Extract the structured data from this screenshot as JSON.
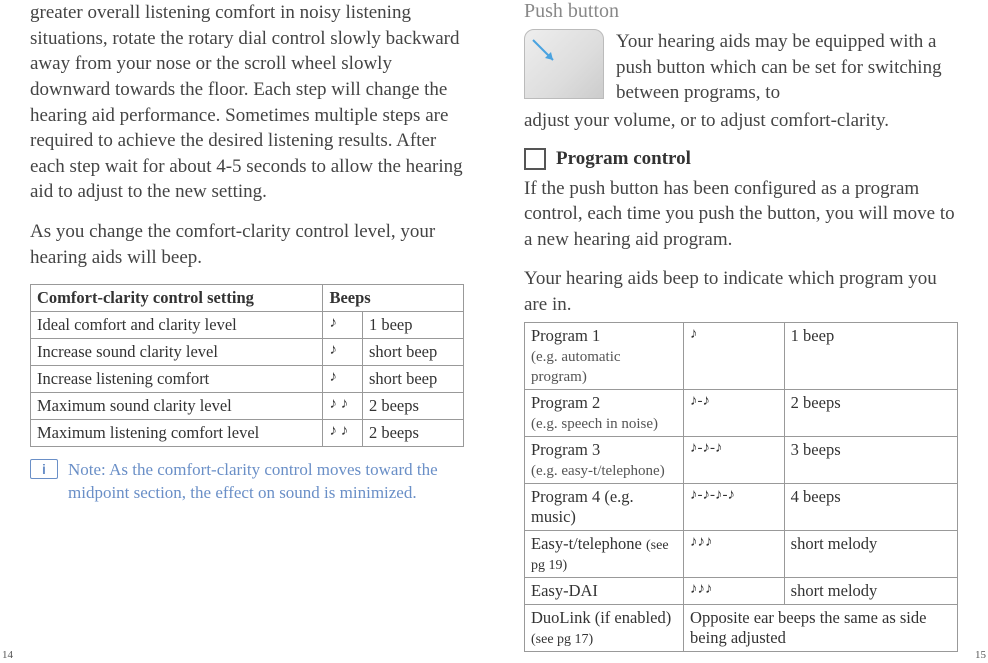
{
  "left": {
    "para1": "greater overall listening comfort in noisy listening situations, rotate the rotary dial control slowly backward away from your nose or the scroll wheel slowly downward towards the floor. Each step will change the hearing aid performance. Sometimes multiple steps are required to achieve the desired listening results. After each step wait for about 4-5 seconds to allow the hearing aid to adjust to the new setting.",
    "para2": "As you change the comfort-clarity control level, your hearing aids will beep.",
    "table": {
      "h1": "Comfort-clarity control setting",
      "h2": "Beeps",
      "rows": [
        {
          "c1": "Ideal comfort and clarity level",
          "icon": "♪",
          "c2": "1 beep"
        },
        {
          "c1": "Increase sound clarity level",
          "icon": "♪",
          "c2": "short beep"
        },
        {
          "c1": "Increase listening comfort",
          "icon": "♪",
          "c2": "short beep"
        },
        {
          "c1": "Maximum sound clarity level",
          "icon": "♪ ♪",
          "c2": "2 beeps"
        },
        {
          "c1": "Maximum listening comfort level",
          "icon": "♪ ♪",
          "c2": "2 beeps"
        }
      ]
    },
    "note_icon": "i",
    "note": "Note: As the comfort-clarity control moves toward the midpoint section, the effect on sound is minimized.",
    "page_num": "14"
  },
  "right": {
    "title": "Push button",
    "push_para_1": "Your hearing aids may be equipped with a push button which can be set for switching between programs, to",
    "push_para_2": "adjust your volume, or to adjust comfort-clarity.",
    "checkbox_label": "Program control",
    "para3": "If the push button has been configured as a program control, each time you push the button, you will move to a new hearing aid program.",
    "para4": "Your hearing aids beep to indicate which program you are in.",
    "table": {
      "rows": [
        {
          "c1a": "Program 1",
          "c1b": "(e.g. automatic program)",
          "icon": "♪",
          "c2": "1 beep"
        },
        {
          "c1a": "Program 2",
          "c1b": "(e.g. speech in noise)",
          "icon": "♪-♪",
          "c2": "2 beeps"
        },
        {
          "c1a": "Program 3",
          "c1b": "(e.g. easy-t/telephone)",
          "icon": "♪-♪-♪",
          "c2": "3 beeps"
        },
        {
          "c1a": "Program 4 (e.g. music)",
          "c1b": "",
          "icon": "♪-♪-♪-♪",
          "c2": "4 beeps"
        },
        {
          "c1a": "Easy-t/telephone ",
          "ref": "(see pg 19)",
          "c1b": "",
          "icon": "♪♪♪",
          "c2": "short melody"
        },
        {
          "c1a": "Easy-DAI",
          "c1b": "",
          "icon": "♪♪♪",
          "c2": "short melody"
        },
        {
          "c1a": "DuoLink (if enabled)",
          "c1b": "(see pg 17)",
          "icon": "",
          "c2": "Opposite ear beeps the same as side being adjusted",
          "merge": true
        }
      ]
    },
    "page_num": "15"
  }
}
